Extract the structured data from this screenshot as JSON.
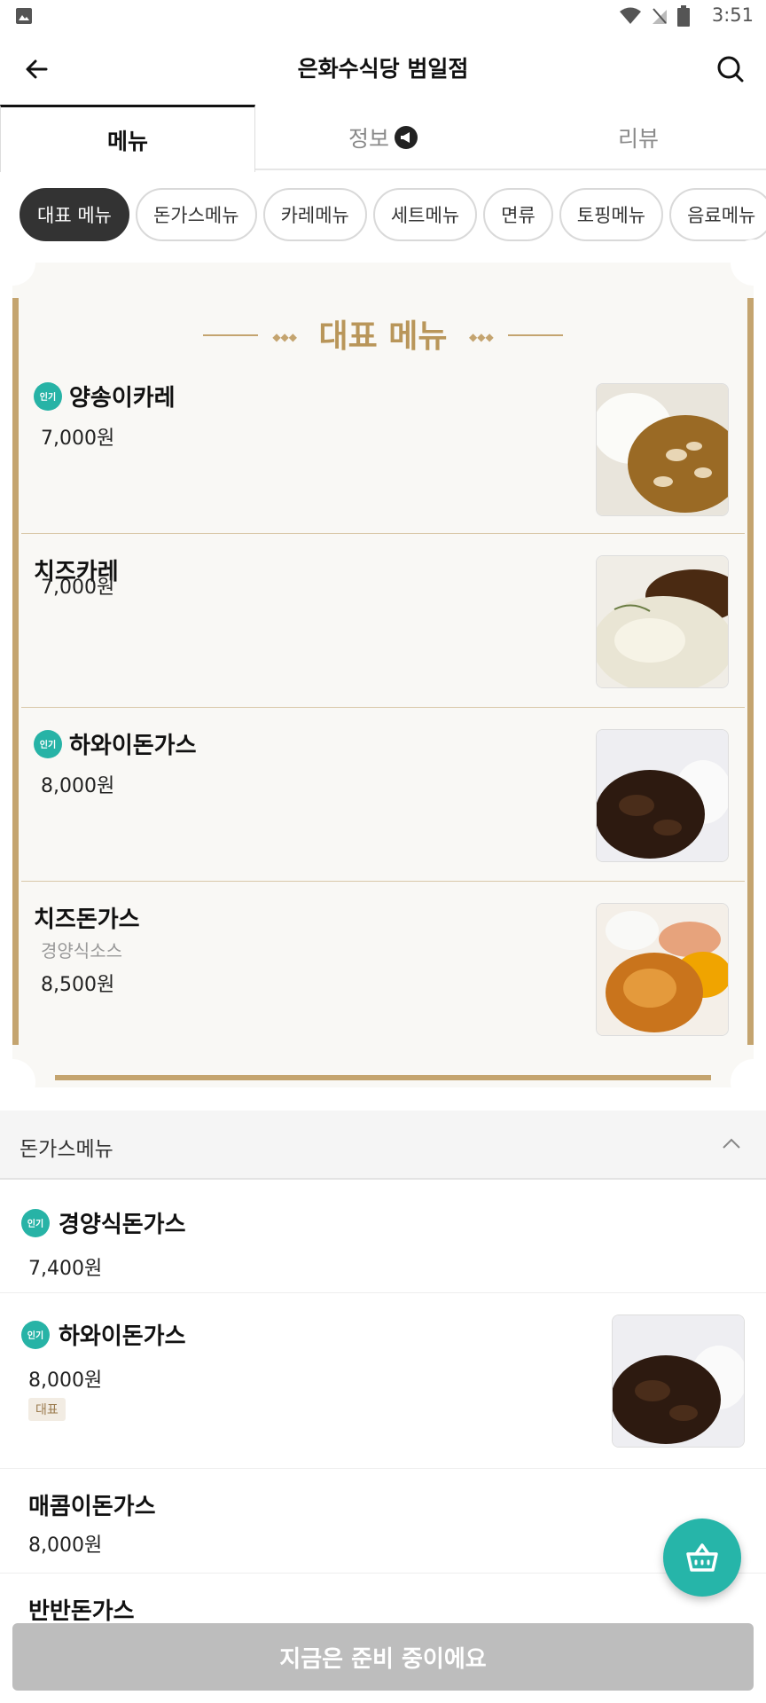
{
  "status_bar": {
    "time": "3:51",
    "icons": [
      "image-icon",
      "wifi-icon",
      "no-signal-icon",
      "battery-icon"
    ]
  },
  "app_bar": {
    "title": "은화수식당 범일점"
  },
  "tabs": [
    {
      "label": "메뉴",
      "active": true
    },
    {
      "label": "정보",
      "active": false,
      "badge_icon": "megaphone-icon"
    },
    {
      "label": "리뷰",
      "active": false
    }
  ],
  "chips": [
    "대표 메뉴",
    "돈가스메뉴",
    "카레메뉴",
    "세트메뉴",
    "면류",
    "토핑메뉴",
    "음료메뉴"
  ],
  "popular_label": "인기",
  "featured": {
    "title": "대표 메뉴",
    "items": [
      {
        "name": "양송이카레",
        "price": "7,000원",
        "popular": true,
        "image": "mushroom-curry-photo"
      },
      {
        "name": "치즈카레",
        "price": "7,000원",
        "popular": false,
        "image": "cheese-curry-photo"
      },
      {
        "name": "하와이돈가스",
        "price": "8,000원",
        "popular": true,
        "image": "hawaii-tonkatsu-photo"
      },
      {
        "name": "치즈돈가스",
        "desc": "경양식소스",
        "price": "8,500원",
        "popular": false,
        "image": "cheese-tonkatsu-photo"
      }
    ]
  },
  "section": {
    "label": "돈가스메뉴",
    "items": [
      {
        "name": "경양식돈가스",
        "price": "7,400원",
        "popular": true
      },
      {
        "name": "하와이돈가스",
        "price": "8,000원",
        "popular": true,
        "tag": "대표",
        "image": "hawaii-tonkatsu-photo"
      },
      {
        "name": "매콤이돈가스",
        "price": "8,000원",
        "popular": false
      },
      {
        "name": "반반돈가스",
        "popular": false
      }
    ]
  },
  "cart_icon": "basket-icon",
  "bottom_button": {
    "label": "지금은 준비 중이에요"
  }
}
